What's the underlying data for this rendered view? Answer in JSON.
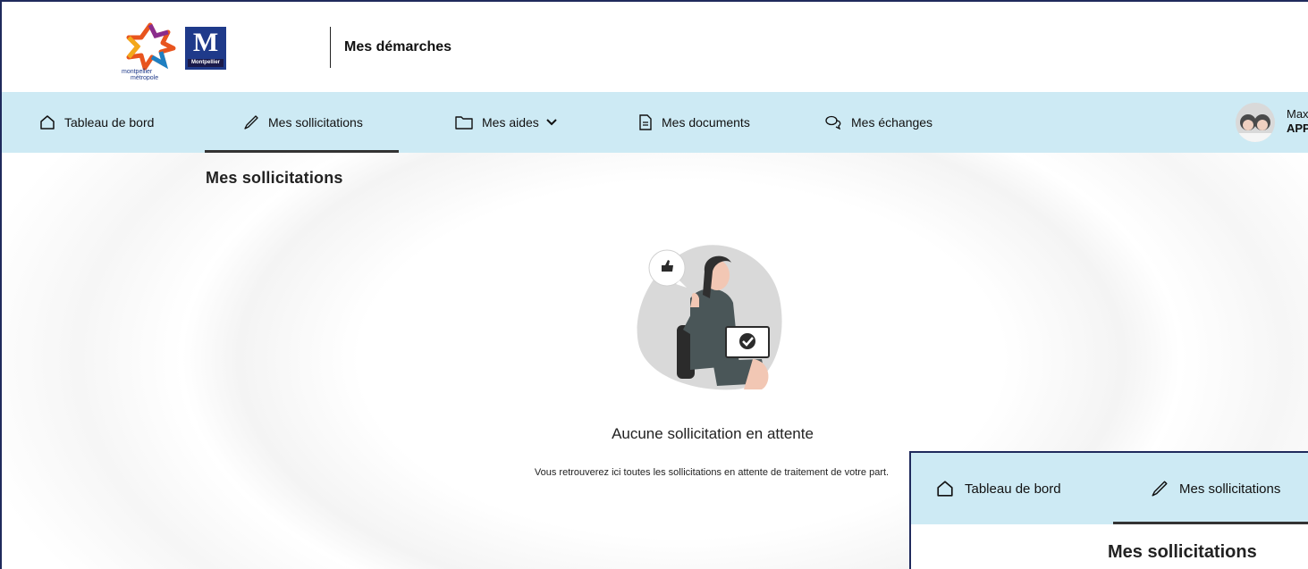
{
  "header": {
    "logo_text": "Montpellier méditerranée Métropole",
    "logo_m_letter": "M",
    "logo_m_caption": "Montpellier",
    "app_title": "Mes démarches"
  },
  "nav": {
    "items": [
      {
        "label": "Tableau de bord",
        "icon": "home-icon"
      },
      {
        "label": "Mes sollicitations",
        "icon": "pen-icon",
        "active": true
      },
      {
        "label": "Mes aides",
        "icon": "folder-icon",
        "dropdown": true
      },
      {
        "label": "Mes documents",
        "icon": "document-icon"
      },
      {
        "label": "Mes échanges",
        "icon": "chat-icon"
      }
    ],
    "user": {
      "name": "Max",
      "role": "APP"
    }
  },
  "main": {
    "heading": "Mes sollicitations",
    "empty_state": {
      "title": "Aucune sollicitation en attente",
      "description": "Vous retrouverez ici toutes les sollicitations en attente de traitement de votre part."
    }
  },
  "inset": {
    "nav_items": [
      {
        "label": "Tableau de bord",
        "icon": "home-icon"
      },
      {
        "label": "Mes sollicitations",
        "icon": "pen-icon",
        "active": true
      }
    ],
    "heading": "Mes sollicitations"
  },
  "colors": {
    "nav_background": "#cdeaf4",
    "brand_blue": "#1f3a8a",
    "active_underline": "#333333"
  }
}
